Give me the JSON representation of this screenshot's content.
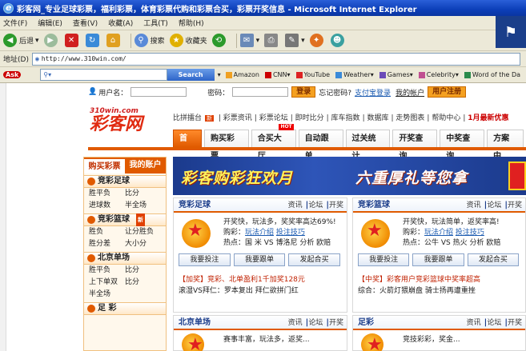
{
  "window": {
    "title": "彩客网_专业足球彩票，福利彩票，体育彩票代购和彩票合买，彩票开奖信息 - Microsoft Internet Explorer"
  },
  "menu": [
    "文件(F)",
    "编辑(E)",
    "查看(V)",
    "收藏(A)",
    "工具(T)",
    "帮助(H)"
  ],
  "toolbar": {
    "back": "后退",
    "search": "搜索",
    "favorites": "收藏夹"
  },
  "address": {
    "label": "地址(D)",
    "url": "http://www.310win.com/"
  },
  "askbar": {
    "brand": "Ask",
    "search_btn": "Search",
    "items": [
      "Amazon",
      "CNN",
      "YouTube",
      "Weather",
      "Games",
      "Celebrity",
      "Word of the Da"
    ]
  },
  "login": {
    "user_label": "用户名：",
    "pass_label": "密码：",
    "login_btn": "登录",
    "forgot": "忘记密码?",
    "alipay": "支付宝登录",
    "account": "我的帐户",
    "register": "用户注册"
  },
  "logo": {
    "url": "310win.com",
    "name": "彩客网"
  },
  "subnav": [
    "比拼擂台",
    "彩票资讯",
    "彩票论坛",
    "即时比分",
    "库车指数",
    "数据库",
    "走势图表",
    "帮助中心"
  ],
  "subnav_hot": "1月最新优惠",
  "new_badge": "新",
  "hot_badge": "HOT",
  "navtabs": [
    "首页",
    "购买彩票",
    "合买大厅",
    "自动跟单",
    "过关统计",
    "开奖查询",
    "中奖查询",
    "方案中"
  ],
  "sidebar": {
    "tab_buy": "购买彩票",
    "tab_account": "我的账户",
    "jczq": {
      "title": "竞彩足球",
      "rows": [
        [
          "胜平负",
          "比分"
        ],
        [
          "进球数",
          "半全场"
        ]
      ]
    },
    "jclq": {
      "title": "竞彩篮球",
      "rows": [
        [
          "胜负",
          "让分胜负"
        ],
        [
          "胜分差",
          "大小分"
        ]
      ]
    },
    "bjdc": {
      "title": "北京单场",
      "rows": [
        [
          "胜平负",
          "比分"
        ],
        [
          "上下单双",
          "比分"
        ],
        [
          "半全场",
          ""
        ]
      ]
    },
    "zc": {
      "title": "足 彩"
    }
  },
  "banner": {
    "t1": "彩客购彩狂欢月",
    "t2": "六重厚礼等您拿"
  },
  "panels": {
    "zq": {
      "title": "竞彩足球",
      "links": [
        "资讯",
        "论坛",
        "开奖"
      ],
      "line1": "开奖快，玩法多，奖奖率高达69%!",
      "line2_label": "购彩：",
      "line2_a": "玩法介绍",
      "line2_b": "投注技巧",
      "line3": "热点：国 米  VS 博洛尼  分析  欧赔",
      "btns": [
        "我要投注",
        "我要跟单",
        "发起合买"
      ],
      "news1": "【加奖】竞彩、北单盈利1千加奖128元",
      "news2": "滚湿VS拜仁：罗本复出  拜仁欲拼门红"
    },
    "lq": {
      "title": "竞彩篮球",
      "links": [
        "资讯",
        "论坛",
        "开奖"
      ],
      "line1": "开奖快，玩法简单，返奖率高!",
      "line2_label": "购彩：",
      "line2_a": "玩法介绍",
      "line2_b": "投注技巧",
      "line3": "热点：公牛 VS 热火  分析  欧赔",
      "btns": [
        "我要投注",
        "我要跟单",
        "发起合买"
      ],
      "news1": "【中奖】彩客用户竞彩篮球中奖率超高",
      "news2": "综合：火箭灯猥崩盘  骑士扬再遭重挫"
    },
    "bd": {
      "title": "北京单场",
      "links": [
        "资讯",
        "论坛",
        "开奖"
      ],
      "line1": "赛事丰富，玩法多，返奖..."
    },
    "zc": {
      "title": "足彩",
      "links": [
        "资讯",
        "论坛",
        "开奖"
      ],
      "line1": "竞技彩彩，奖金..."
    }
  }
}
